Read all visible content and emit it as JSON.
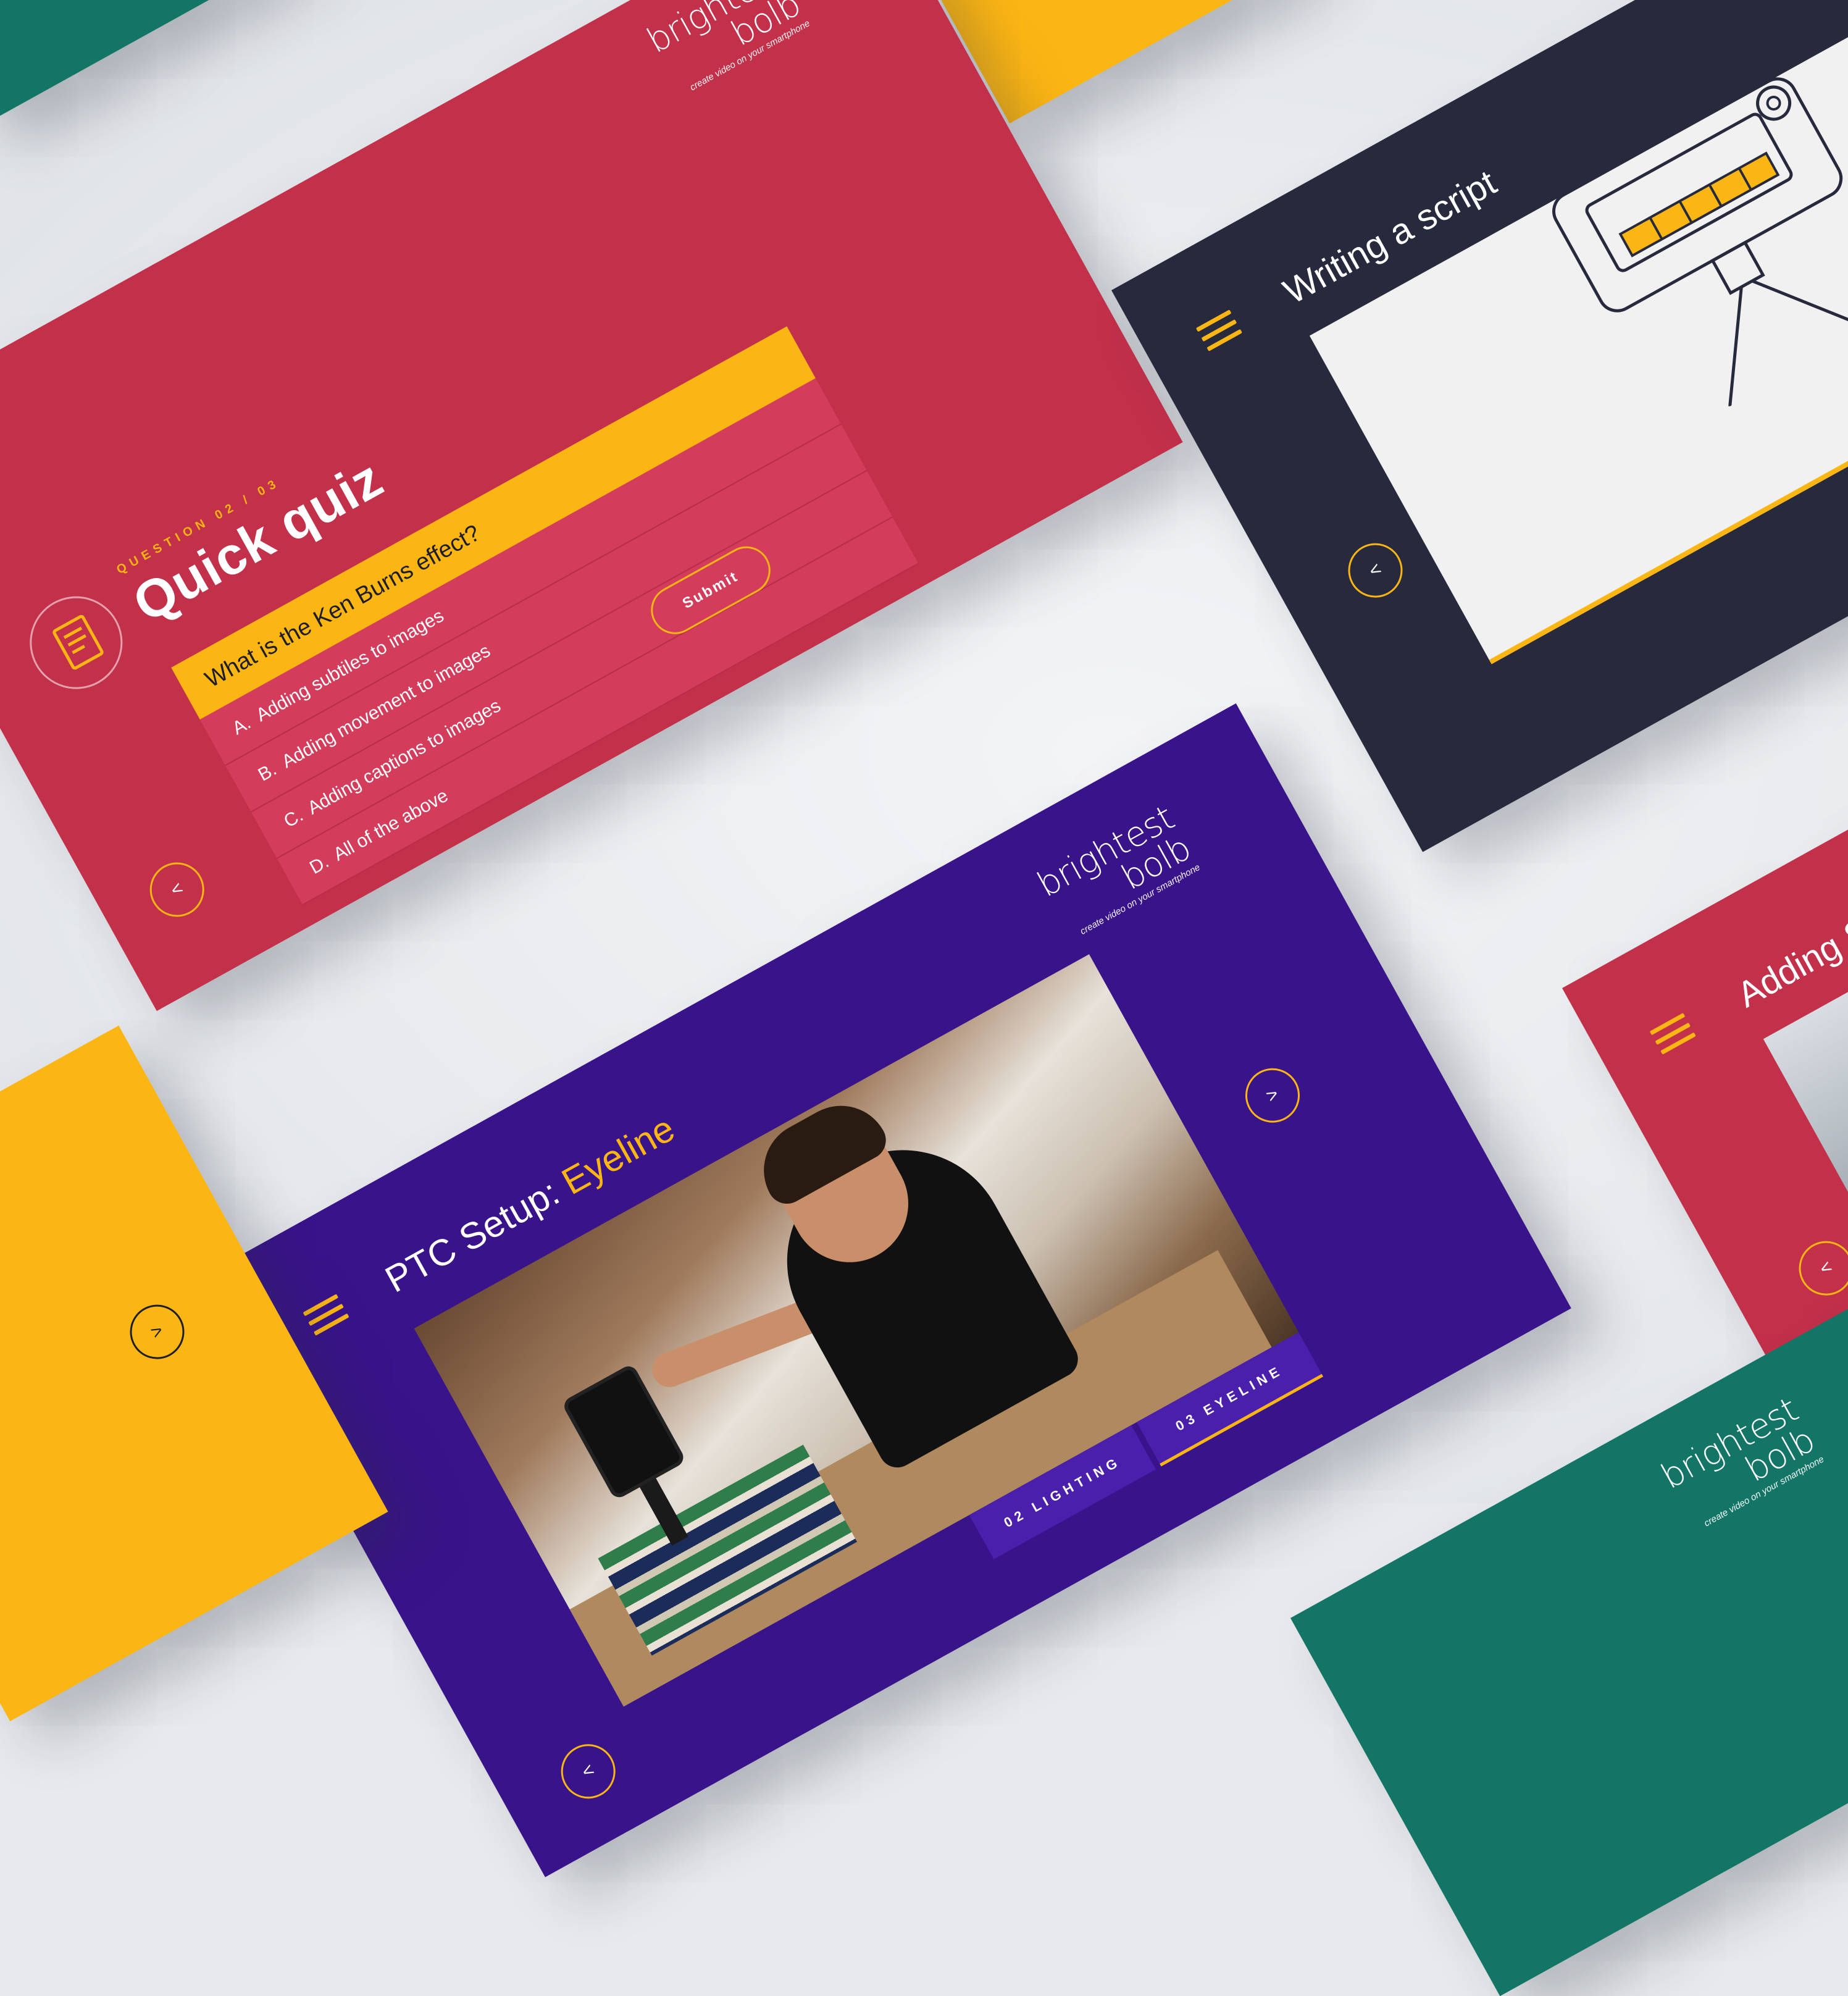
{
  "brand": {
    "logo_word": "brightest bolb",
    "tagline": "create video on your smartphone"
  },
  "quiz_slide": {
    "eyebrow": "QUESTION 02 / 03",
    "title": "Quick quiz",
    "question": "What is the Ken Burns effect?",
    "options": [
      {
        "letter": "A.",
        "text": "Adding subtiles to images"
      },
      {
        "letter": "B.",
        "text": "Adding movement to images"
      },
      {
        "letter": "C.",
        "text": "Adding captions to images"
      },
      {
        "letter": "D.",
        "text": "All of the above"
      }
    ],
    "submit_label": "Submit",
    "prev_label": "<"
  },
  "script_slide": {
    "title": "Writing a script",
    "prev_label": "<"
  },
  "ptc_slide": {
    "title_main": "PTC Setup: ",
    "title_accent": "Eyeline",
    "next_label": ">",
    "prev_label": "<",
    "tabs": [
      {
        "label": "02 LIGHTING"
      },
      {
        "label": "03 EYELINE"
      }
    ]
  },
  "subtitles_slide": {
    "title": "Adding Su",
    "prev_label": "<"
  },
  "yellow_slide": {
    "next_label": ">"
  },
  "colors": {
    "red": "#c3304a",
    "navy": "#272a3d",
    "purple": "#39138a",
    "yellow": "#fcb614",
    "green": "#127565"
  }
}
